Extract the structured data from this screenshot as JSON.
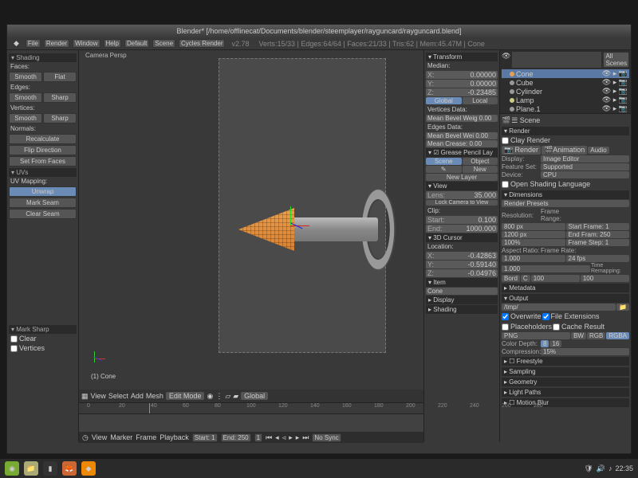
{
  "title": "Blender* [/home/offlinecat/Documents/blender/steemplayer/rayguncard/rayguncard.blend]",
  "menu": {
    "file": "File",
    "render": "Render",
    "window": "Window",
    "help": "Help",
    "layout": "Default",
    "scene": "Scene",
    "engine": "Cycles Render",
    "version": "v2.78"
  },
  "info": "Verts:15/33 | Edges:64/64 | Faces:21/33 | Tris:62 | Mem:45.47M | Cone",
  "toolshelf": {
    "shading_hdr": "▾ Shading",
    "faces": "Faces:",
    "edges": "Edges:",
    "vertices": "Vertices:",
    "normals": "Normals:",
    "smooth": "Smooth",
    "flat": "Flat",
    "sharp": "Sharp",
    "recalc": "Recalculate",
    "flip": "Flip Direction",
    "setfrom": "Set From Faces",
    "uvs": "▾ UVs",
    "uvmap": "UV Mapping:",
    "unwrap": "Unwrap",
    "markseam": "Mark Seam",
    "clearseam": "Clear Seam",
    "marksharp_hdr": "▾ Mark Sharp",
    "clear": "Clear",
    "verts_chk": "Vertices"
  },
  "viewport": {
    "cam": "Camera Persp",
    "obj": "(1) Cone"
  },
  "v3dheader": {
    "view": "View",
    "select": "Select",
    "add": "Add",
    "mesh": "Mesh",
    "mode": "Edit Mode",
    "orient": "Global"
  },
  "timeline": {
    "menu": {
      "view": "View",
      "marker": "Marker",
      "frame": "Frame",
      "playback": "Playback"
    },
    "start": "Start: 1",
    "end": "End: 250",
    "cur": "1",
    "nosync": "No Sync",
    "ticks": [
      "0",
      "20",
      "40",
      "60",
      "80",
      "100",
      "120",
      "140",
      "160",
      "180",
      "200",
      "220",
      "240",
      "260",
      "280"
    ]
  },
  "npanel": {
    "transform": "▾ Transform",
    "median": "Median:",
    "x": "X:",
    "y": "Y:",
    "z": "Z:",
    "xv": "0.00000",
    "yv": "0.00000",
    "zv": "-0.23485",
    "global": "Global",
    "local": "Local",
    "vdata": "Vertices Data:",
    "bevel": "Mean Bevel Weig 0.00",
    "edata": "Edges Data:",
    "ebevel": "Mean Bevel Wei 0.00",
    "crease": "Mean Crease:  0.00",
    "gp": "▾ ☑ Grease Pencil Lay",
    "scene": "Scene",
    "object": "Object",
    "new": "New",
    "newlayer": "New Layer",
    "view": "▾ View",
    "lens": "Lens:",
    "lensv": "35.000",
    "clip": "Clip:",
    "start": "Start:",
    "startv": "0.100",
    "end": "End:",
    "endv": "1000.000",
    "lockcam": "Lock Camera to View",
    "cursor": "▾ 3D Cursor",
    "loc": "Location:",
    "cx": "-0.42863",
    "cy": "-0.59140",
    "cz": "-0.04976",
    "item": "▾ Item",
    "itemv": "Cone",
    "display": "▸ Display",
    "shading": "▸ Shading"
  },
  "outliner": {
    "search": "",
    "all": "All Scenes",
    "items": [
      {
        "name": "Cone",
        "color": "#e8a050",
        "sel": true
      },
      {
        "name": "Cube",
        "color": "#999",
        "sel": false
      },
      {
        "name": "Cylinder",
        "color": "#999",
        "sel": false
      },
      {
        "name": "Lamp",
        "color": "#cc8",
        "sel": false
      },
      {
        "name": "Plane.1",
        "color": "#999",
        "sel": false
      }
    ]
  },
  "props": {
    "scene": "☰ Scene",
    "render_hdr": "▾ Render",
    "clayrender": "Clay Render",
    "render": "Render",
    "anim": "Animation",
    "audio": "Audio",
    "display": "Display:",
    "displayv": "Image Editor",
    "feature": "Feature Set:",
    "featurev": "Supported",
    "device": "Device:",
    "devicev": "CPU",
    "osl": "Open Shading Language",
    "dim_hdr": "▾ Dimensions",
    "preset": "Render Presets",
    "res": "Resolution:",
    "fr": "Frame Range:",
    "resx": "800 px",
    "resy": "1200 px",
    "resp": "100%",
    "sf": "Start Frame: 1",
    "ef": "End Fram: 250",
    "fs": "Frame Step: 1",
    "ar": "Aspect Ratio:",
    "frate": "Frame Rate:",
    "arx": "1.000",
    "ary": "1.000",
    "fps": "24 fps",
    "tr": "Time Remapping:",
    "bord": "Bord",
    "crop": "C",
    "old": "100",
    "new": "100",
    "meta": "▸ Metadata",
    "out_hdr": "▾ Output",
    "path": "/tmp/",
    "overwrite": "Overwrite",
    "fileext": "File Extensions",
    "placehold": "Placeholders",
    "cache": "Cache Result",
    "fmt": "PNG",
    "bw": "BW",
    "rgb": "RGB",
    "rgba": "RGBA",
    "depth": "Color Depth:",
    "d8": "8",
    "d16": "16",
    "comp": "Compression:",
    "compv": "15%",
    "freestyle": "▸ ☐ Freestyle",
    "sampling": "▸ Sampling",
    "geom": "▸ Geometry",
    "lightpaths": "▸ Light Paths",
    "mblur": "▸ ☐ Motion Blur"
  },
  "taskbar": {
    "time": "22:35"
  }
}
